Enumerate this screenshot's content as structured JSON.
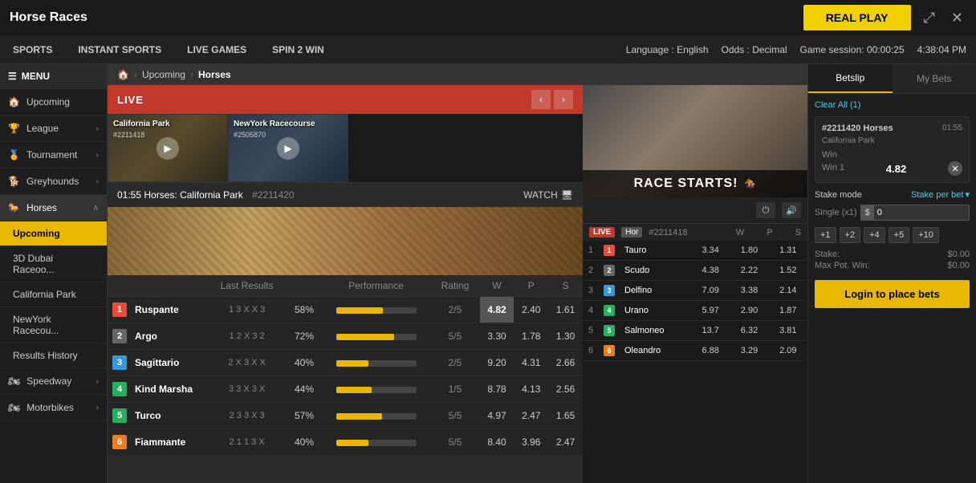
{
  "app": {
    "title": "Horse Races",
    "real_play_label": "REAL PLAY",
    "close_label": "✕",
    "expand_label": "⤢"
  },
  "navbar": {
    "sports": "SPORTS",
    "instant_sports": "INSTANT SPORTS",
    "live_games": "LIVE GAMES",
    "spin2win": "SPIN 2 WIN",
    "language": "Language : English",
    "odds": "Odds : Decimal",
    "game_session": "Game session: 00:00:25",
    "time": "4:38:04 PM"
  },
  "sidebar": {
    "menu_label": "MENU",
    "items": [
      {
        "label": "Upcoming",
        "icon": "🏠"
      },
      {
        "label": "League",
        "icon": "🏆"
      },
      {
        "label": "Tournament",
        "icon": "🏅"
      },
      {
        "label": "Greyhounds",
        "icon": "🐕"
      },
      {
        "label": "Horses",
        "icon": "🐎",
        "expanded": true
      },
      {
        "label": "Speedway",
        "icon": "🏍"
      },
      {
        "label": "Motorbikes",
        "icon": "🏍"
      }
    ],
    "horses_sub": [
      {
        "label": "Upcoming",
        "active": true
      },
      {
        "label": "3D Dubai Raceoo..."
      },
      {
        "label": "California Park"
      },
      {
        "label": "NewYork Racecou..."
      },
      {
        "label": "Results History"
      }
    ]
  },
  "breadcrumb": {
    "home": "🏠",
    "upcoming": "Upcoming",
    "horses": "Horses"
  },
  "live_section": {
    "live_label": "LIVE",
    "thumbnails": [
      {
        "title": "California Park",
        "id": "#2211418"
      },
      {
        "title": "NewYork Racecourse",
        "id": "#2505870"
      }
    ]
  },
  "race_bar": {
    "time": "01:55",
    "type": "Horses:",
    "venue": "California Park",
    "id": "#2211420",
    "watch": "WATCH"
  },
  "table": {
    "headers": [
      "",
      "",
      "Last Results",
      "",
      "Performance",
      "Rating",
      "W",
      "P",
      "S"
    ],
    "col_last_results": "Last Results",
    "col_performance": "Performance",
    "col_rating": "Rating",
    "col_w": "W",
    "col_p": "P",
    "col_s": "S",
    "rows": [
      {
        "num": 1,
        "name": "Ruspante",
        "last": "1 3 X X 3",
        "perf": 58,
        "perf_label": "58%",
        "fraction": "2/5",
        "w": "4.82",
        "p": "2.40",
        "s": "1.61",
        "highlighted": true
      },
      {
        "num": 2,
        "name": "Argo",
        "last": "1 2 X 3 2",
        "perf": 72,
        "perf_label": "72%",
        "fraction": "5/5",
        "w": "3.30",
        "p": "1.78",
        "s": "1.30",
        "highlighted": false
      },
      {
        "num": 3,
        "name": "Sagittario",
        "last": "2 X 3 X X",
        "perf": 40,
        "perf_label": "40%",
        "fraction": "2/5",
        "w": "9.20",
        "p": "4.31",
        "s": "2.66",
        "highlighted": false
      },
      {
        "num": 4,
        "name": "Kind Marsha",
        "last": "3 3 X 3 X",
        "perf": 44,
        "perf_label": "44%",
        "fraction": "1/5",
        "w": "8.78",
        "p": "4.13",
        "s": "2.56",
        "highlighted": false
      },
      {
        "num": 5,
        "name": "Turco",
        "last": "2 3 3 X 3",
        "perf": 57,
        "perf_label": "57%",
        "fraction": "5/5",
        "w": "4.97",
        "p": "2.47",
        "s": "1.65",
        "highlighted": false
      },
      {
        "num": 6,
        "name": "Fiammante",
        "last": "2 1 1 3 X",
        "perf": 40,
        "perf_label": "40%",
        "fraction": "5/5",
        "w": "8.40",
        "p": "3.96",
        "s": "2.47",
        "highlighted": false
      }
    ]
  },
  "live_odds": {
    "live_label": "LIVE",
    "race_label": "Hor",
    "race_id": "#2211418",
    "headers": [
      "",
      "",
      "W",
      "P",
      "S"
    ],
    "rows": [
      {
        "pos": 1,
        "num": 1,
        "name": "Tauro",
        "w": "3.34",
        "p": "1.80",
        "s": "1.31"
      },
      {
        "pos": 2,
        "num": 2,
        "name": "Scudo",
        "w": "4.38",
        "p": "2.22",
        "s": "1.52"
      },
      {
        "pos": 3,
        "num": 3,
        "name": "Delfino",
        "w": "7.09",
        "p": "3.38",
        "s": "2.14"
      },
      {
        "pos": 4,
        "num": 4,
        "name": "Urano",
        "w": "5.97",
        "p": "2.90",
        "s": "1.87"
      },
      {
        "pos": 5,
        "num": 5,
        "name": "Salmoneo",
        "w": "13.7",
        "p": "6.32",
        "s": "3.81"
      },
      {
        "pos": 6,
        "num": 6,
        "name": "Oleandro",
        "w": "6.88",
        "p": "3.29",
        "s": "2.09"
      }
    ],
    "race_starts": "RACE STARTS!"
  },
  "betslip": {
    "tab_betslip": "Betslip",
    "tab_mybets": "My Bets",
    "clear_all": "Clear All (1)",
    "bet": {
      "id": "#2211420 Horses",
      "time": "01:55",
      "venue": "California Park",
      "type": "Win",
      "sub_type": "Win 1",
      "value": "4.82"
    },
    "stake_mode_label": "Stake mode",
    "stake_per_bet": "Stake per bet",
    "single_label": "Single (x1)",
    "dollar_sign": "$",
    "stake_value": "0",
    "quick_bets": [
      "+1",
      "+2",
      "+4",
      "+5",
      "+10"
    ],
    "stake_label": "Stake:",
    "stake_amount": "$0.00",
    "max_pot_win_label": "Max Pot. Win:",
    "max_pot_amount": "$0.00",
    "login_btn": "Login to place bets"
  }
}
